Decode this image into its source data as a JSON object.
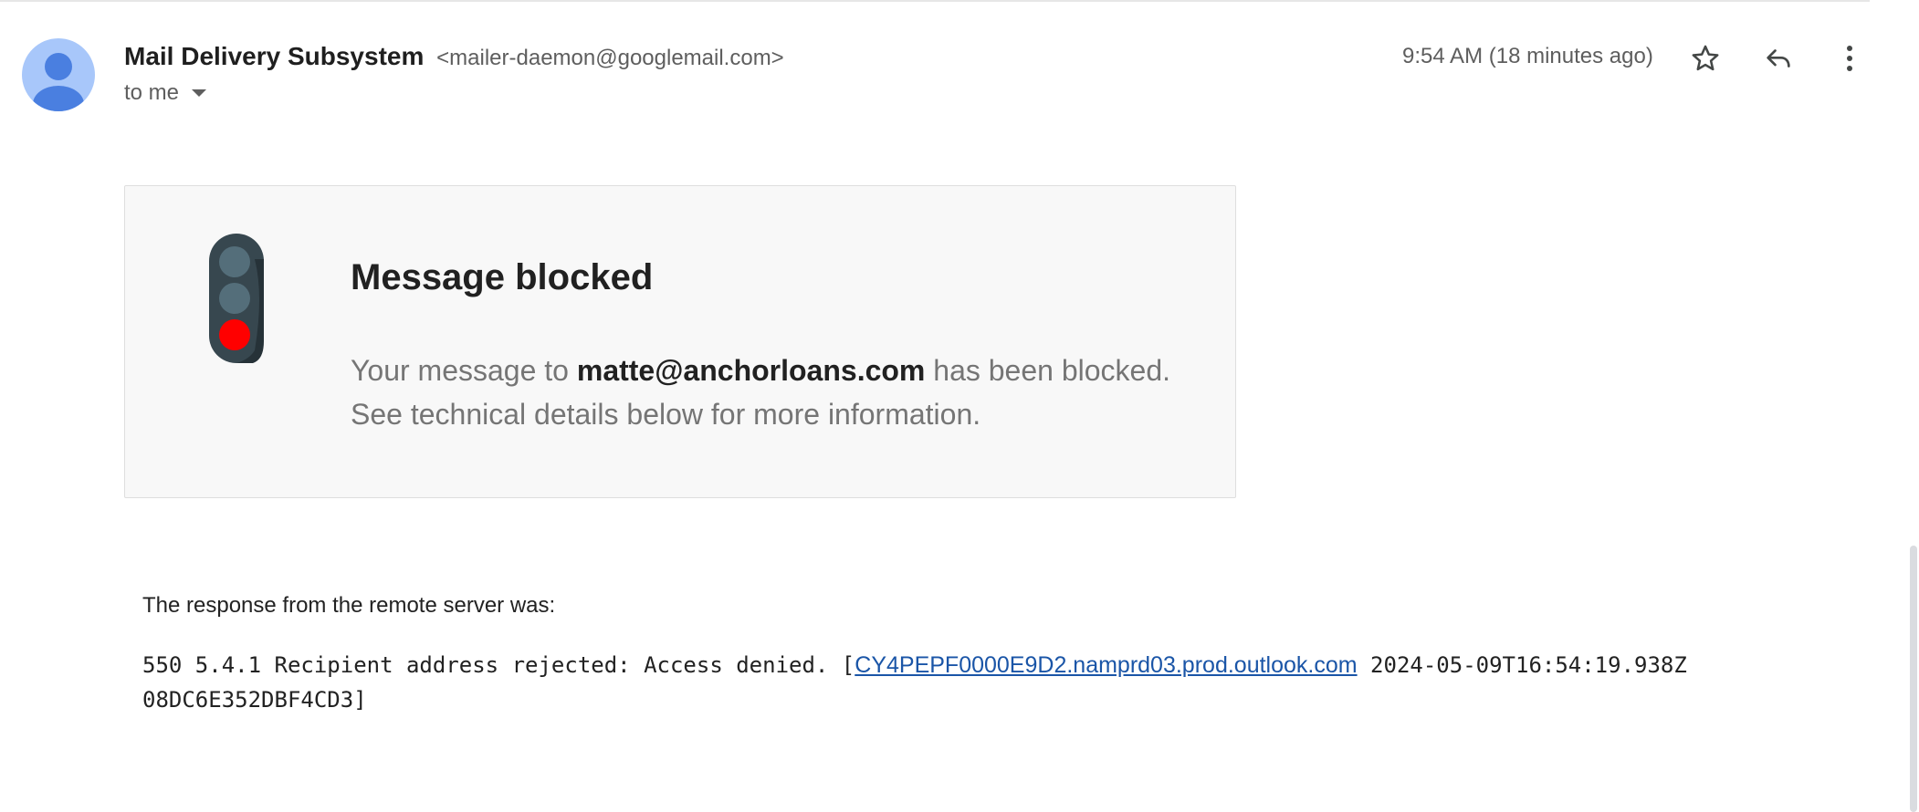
{
  "email": {
    "sender_name": "Mail Delivery Subsystem",
    "sender_email": "<mailer-daemon@googlemail.com>",
    "recipient_summary": "to me",
    "time": "9:54 AM (18 minutes ago)",
    "icons": {
      "avatar": "default-person-avatar",
      "star": "star-outline-icon",
      "reply": "reply-icon",
      "more": "more-vert-icon",
      "expand": "caret-down-icon"
    }
  },
  "card": {
    "icon": "traffic-light-red-icon",
    "title": "Message blocked",
    "body_prefix": "Your message to",
    "recipient": "matte@anchorloans.com",
    "body_suffix": "has been blocked.",
    "body_line2": "See technical details below for more information."
  },
  "details": {
    "label": "The response from the remote server was:",
    "error_prefix": "550 5.4.1 Recipient address rejected: Access denied. [",
    "server_link": "CY4PEPF0000E9D2.namprd03.prod.outlook.com",
    "error_timestamp": "2024-05-09T16:54:19.938Z",
    "error_line2": "08DC6E352DBF4CD3]"
  },
  "colors": {
    "light_red": "#ff0000",
    "light_off": "#546e7a",
    "light_body": "#37474f",
    "avatar_bg": "#a8c7fa",
    "avatar_fg": "#4a7fe0",
    "link": "#1a55a7"
  }
}
